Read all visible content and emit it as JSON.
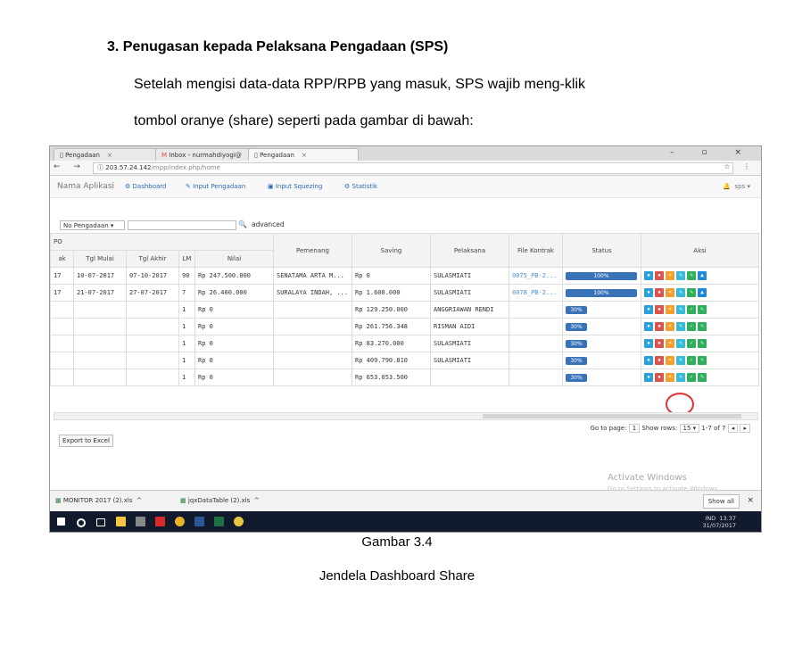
{
  "document": {
    "heading": "3.  Penugasan kepada Pelaksana Pengadaan (SPS)",
    "para_line1": "Setelah mengisi data-data RPP/RPB yang masuk, SPS wajib meng-klik",
    "para_line2": "tombol oranye (share) seperti pada gambar di bawah:",
    "caption_number": "Gambar 3.4",
    "caption_title": "Jendela Dashboard Share"
  },
  "browser": {
    "tabs": [
      {
        "label": "Pengadaan"
      },
      {
        "label": "Inbox - nurmahdiyogi@"
      },
      {
        "label": "Pengadaan"
      }
    ],
    "url_host": "203.57.24.142",
    "url_path": "/mpp/index.php/home"
  },
  "app": {
    "name": "Nama Aplikasi",
    "nav": [
      "Dashboard",
      "Input Pengadaan",
      "Input Squezing",
      "Statistik"
    ],
    "user": "sps"
  },
  "filter": {
    "select_value": "No Pengadaan",
    "advanced_label": "advanced"
  },
  "table": {
    "group_header": "PO",
    "headers": [
      "ak",
      "Tgl Mulai",
      "Tgl Akhir",
      "LM",
      "Nilai",
      "Pemenang",
      "Saving",
      "Pelaksana",
      "File Kontrak",
      "Status",
      "Aksi"
    ],
    "rows": [
      {
        "ak": "17",
        "mulai": "10-07-2017",
        "akhir": "07-10-2017",
        "lm": "90",
        "nilai": "Rp 247.500.000",
        "pemenang": "SENATAMA ARTA M...",
        "saving": "Rp 0",
        "pelaksana": "SULASMIATI",
        "file": "0075_PB-2...",
        "status": "100%",
        "status_fraction": 1.0
      },
      {
        "ak": "17",
        "mulai": "21-07-2017",
        "akhir": "27-07-2017",
        "lm": "7",
        "nilai": "Rp 26.400.000",
        "pemenang": "SURALAYA INDAH, ...",
        "saving": "Rp 1.600.000",
        "pelaksana": "SULASMIATI",
        "file": "0078_PB-2...",
        "status": "100%",
        "status_fraction": 1.0
      },
      {
        "ak": "",
        "mulai": "",
        "akhir": "",
        "lm": "1",
        "nilai": "Rp 0",
        "pemenang": "",
        "saving": "Rp 129.250.000",
        "pelaksana": "ANGGRIAWAN RENDI",
        "file": "",
        "status": "30%",
        "status_fraction": 0.3
      },
      {
        "ak": "",
        "mulai": "",
        "akhir": "",
        "lm": "1",
        "nilai": "Rp 0",
        "pemenang": "",
        "saving": "Rp 261.756.348",
        "pelaksana": "RISMAN AIDI",
        "file": "",
        "status": "30%",
        "status_fraction": 0.3
      },
      {
        "ak": "",
        "mulai": "",
        "akhir": "",
        "lm": "1",
        "nilai": "Rp 0",
        "pemenang": "",
        "saving": "Rp 83.270.000",
        "pelaksana": "SULASMIATI",
        "file": "",
        "status": "30%",
        "status_fraction": 0.3
      },
      {
        "ak": "",
        "mulai": "",
        "akhir": "",
        "lm": "1",
        "nilai": "Rp 0",
        "pemenang": "",
        "saving": "Rp 409.790.810",
        "pelaksana": "SULASMIATI",
        "file": "",
        "status": "30%",
        "status_fraction": 0.3
      },
      {
        "ak": "",
        "mulai": "",
        "akhir": "",
        "lm": "1",
        "nilai": "Rp 0",
        "pemenang": "",
        "saving": "Rp 653.053.500",
        "pelaksana": "",
        "file": "",
        "status": "30%",
        "status_fraction": 0.3
      }
    ]
  },
  "pager": {
    "go_to_label": "Go to page:",
    "page": "1",
    "show_rows_label": "Show rows:",
    "rows": "15",
    "range": "1-7 of 7"
  },
  "export_label": "Export to Excel",
  "watermark": {
    "line1": "Activate Windows",
    "line2": "Go to Settings to activate Windows."
  },
  "downloads": {
    "item1": "MONITOR 2017 (2).xls",
    "item2": "jqxDataTable (2).xls",
    "show_all": "Show all"
  },
  "taskbar": {
    "time": "13.37",
    "date": "31/07/2017",
    "lang": "IND"
  },
  "colors": {
    "status_blue": "#3a72b8",
    "share_orange": "#f0a030",
    "highlight_red": "#e53030"
  }
}
